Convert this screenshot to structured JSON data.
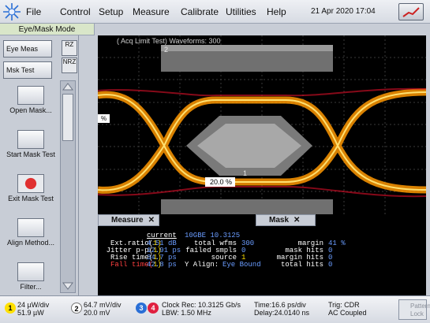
{
  "menu": {
    "items": [
      "File",
      "Control",
      "Setup",
      "Measure",
      "Calibrate",
      "Utilities",
      "Help"
    ],
    "datetime": "21 Apr 2020  17:04"
  },
  "mode_label": "Eye/Mask Mode",
  "left_panel": {
    "eye_meas": "Eye Meas",
    "msk_test": "Msk Test",
    "rz": "RZ",
    "nrz": "NRZ",
    "tools": [
      {
        "label": "Open Mask...",
        "icon": "open-mask-icon"
      },
      {
        "label": "Start Mask Test",
        "icon": "start-mask-test-icon"
      },
      {
        "label": "Exit Mask Test",
        "icon": "exit-mask-test-icon"
      },
      {
        "label": "Align Method...",
        "icon": "align-method-icon"
      },
      {
        "label": "Filter...",
        "icon": "filter-icon"
      }
    ]
  },
  "scope": {
    "title": "( Acq Limit Test)  Waveforms: 300",
    "marker_pct_left": "%",
    "marker_pct_mid": "20.0 %",
    "region_1": "1",
    "region_2": "2",
    "trace_color": "#ffb000"
  },
  "measure": {
    "tab_label": "Measure",
    "mask_tab_label": "Mask",
    "header": "current",
    "rows": [
      {
        "name": "Ext.ratio(",
        "value": "4.51 dB",
        "color": "#ffffff"
      },
      {
        "name": "Jitter p-p(",
        "value": "12.91 ps",
        "color": "#ffffff"
      },
      {
        "name": "Rise time(",
        "value": "34.7 ps",
        "color": "#ffffff"
      },
      {
        "name": "Fall time(",
        "value": "42.8 ps",
        "color": "#ff4040"
      }
    ],
    "info_title": "10GBE 10.3125",
    "total_wfms_label": "total wfms",
    "total_wfms": "300",
    "failed_smpls_label": "failed smpls",
    "failed_smpls": "0",
    "source_label": "source",
    "source": "1",
    "y_align_label": "Y Align:",
    "y_align": "Eye Bound",
    "margin_label": "margin",
    "margin": "41 %",
    "mask_hits_label": "mask hits",
    "mask_hits": "0",
    "margin_hits_label": "margin hits",
    "margin_hits": "0",
    "total_hits_label": "total hits",
    "total_hits": "0"
  },
  "bottom": {
    "ch1_num": "1",
    "ch1_l1": "24 µW/div",
    "ch1_l2": "51.9 µW",
    "ch2_num": "2",
    "ch2_l1": "64.7 mV/div",
    "ch2_l2": "20.0 mV",
    "ch3_num": "3",
    "ch4_num": "4",
    "clock_l1": "Clock Rec: 10.3125 Gb/s",
    "clock_l2": "LBW: 1.50 MHz",
    "time_l1": "Time:16.6 ps/div",
    "time_l2": "Delay:24.0140 ns",
    "trig_l1": "Trig: CDR",
    "trig_l2": "AC Coupled",
    "lock_l1": "Pattern",
    "lock_l2": "Lock"
  }
}
